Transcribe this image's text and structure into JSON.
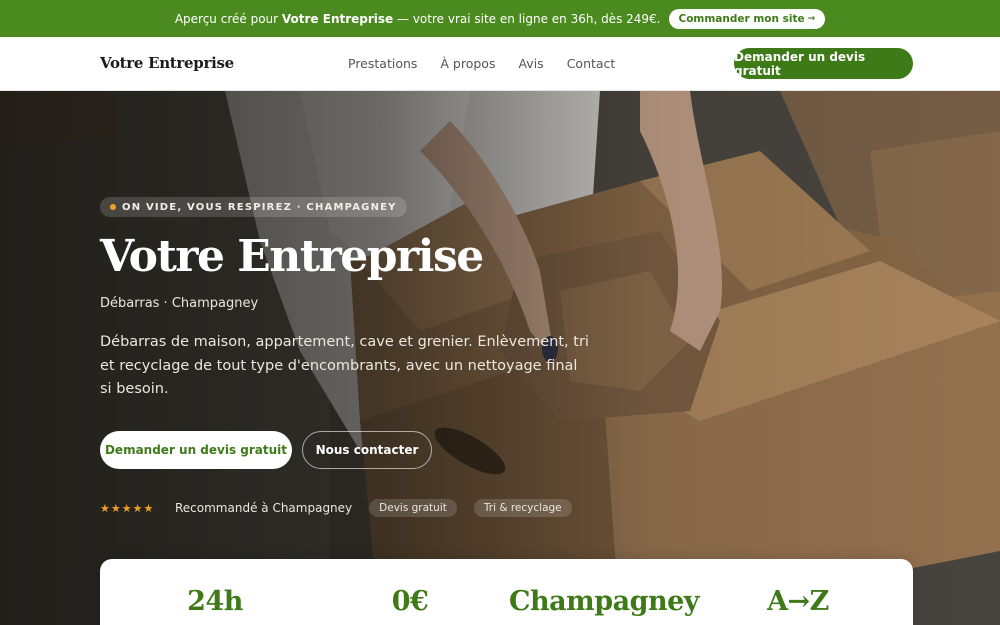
{
  "promo": {
    "lead": "Aperçu créé pour",
    "company": "Votre Entreprise",
    "text": "— votre vrai site en ligne en 36h, dès 249€.",
    "button": "Commander mon site",
    "button_arrow": "→"
  },
  "header": {
    "brand": "Votre Entreprise",
    "nav": [
      "Prestations",
      "À propos",
      "Avis",
      "Contact"
    ],
    "cta": "Demander un devis gratuit"
  },
  "hero": {
    "eyebrow": "ON VIDE, VOUS RESPIREZ · CHAMPAGNEY",
    "title": "Votre Entreprise",
    "subtitle": "Débarras · Champagney",
    "description": "Débarras de maison, appartement, cave et grenier. Enlèvement, tri et recyclage de tout type d'encombrants, avec un nettoyage final si besoin.",
    "primary_button": "Demander un devis gratuit",
    "secondary_button": "Nous contacter",
    "stars": "★★★★★",
    "trust_text": "Recommandé à Champagney",
    "pills": [
      "Devis gratuit",
      "Tri & recyclage"
    ]
  },
  "stats": [
    "24h",
    "0€",
    "Champagney",
    "A→Z"
  ],
  "colors": {
    "brand_green": "#3f7a18",
    "promo_green": "#4a8a1f",
    "accent_orange": "#f0a028"
  }
}
